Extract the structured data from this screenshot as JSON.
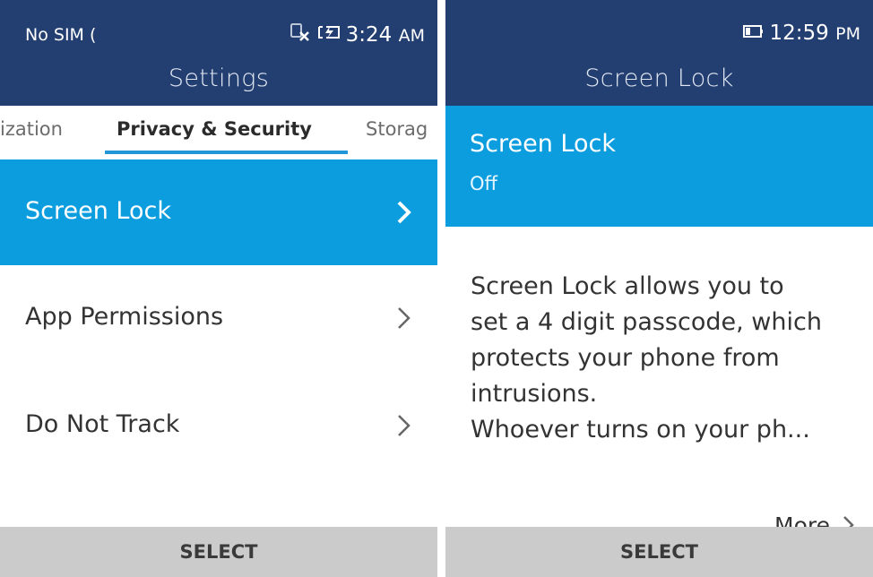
{
  "left": {
    "status": {
      "carrier": "No SIM",
      "time": "3:24",
      "ampm": "AM"
    },
    "title": "Settings",
    "tabs": [
      "ization",
      "Privacy & Security",
      "Storag"
    ],
    "items": [
      "Screen Lock",
      "App Permissions",
      "Do Not Track"
    ],
    "softkey": "SELECT"
  },
  "right": {
    "status": {
      "time": "12:59",
      "ampm": "PM"
    },
    "title": "Screen Lock",
    "setting_name": "Screen Lock",
    "setting_value": "Off",
    "description_lines": [
      "Screen Lock allows you to",
      "set a 4 digit passcode, which",
      "protects your phone from",
      "intrusions.",
      "Whoever turns on your ph..."
    ],
    "more_label": "More",
    "softkey": "SELECT"
  },
  "colors": {
    "header": "#233f71",
    "accent": "#0c9ddf",
    "tab_underline": "#2196d8",
    "softkey": "#cbcbcb"
  },
  "icons": [
    "no-sim-icon",
    "battery-charging-icon",
    "battery-icon",
    "chevron-right-icon"
  ]
}
